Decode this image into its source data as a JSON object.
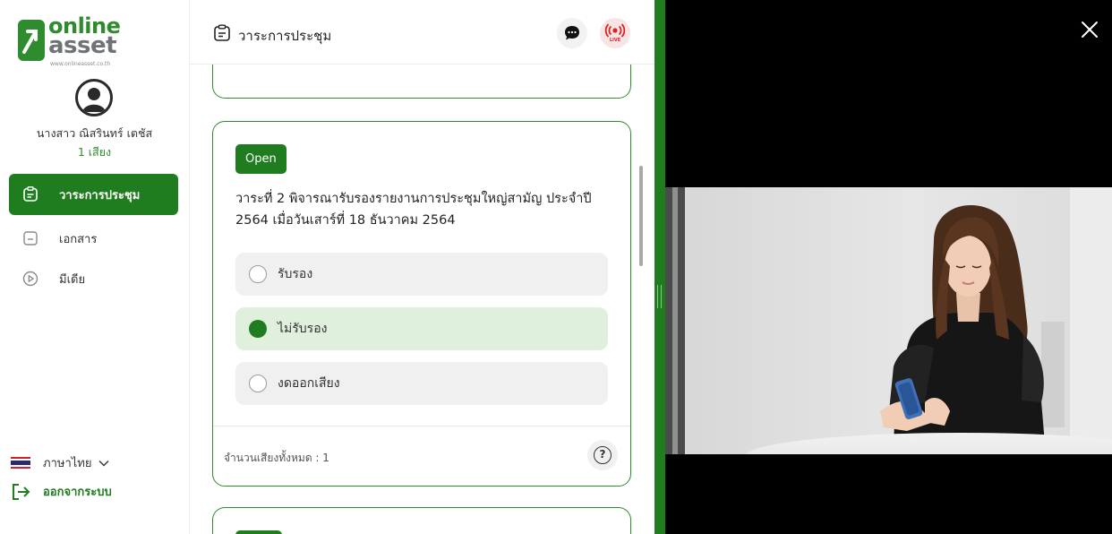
{
  "logo": {
    "brand_top": "online",
    "brand_bottom": "asset",
    "url": "www.onlineasset.co.th"
  },
  "user": {
    "name": "นางสาว ณิสรินทร์ เตชัส",
    "votes": "1 เสียง"
  },
  "sidebar": {
    "items": [
      {
        "label": "วาระการประชุม",
        "icon": "agenda-icon",
        "active": true
      },
      {
        "label": "เอกสาร",
        "icon": "document-icon",
        "active": false
      },
      {
        "label": "มีเดีย",
        "icon": "media-play-icon",
        "active": false
      }
    ],
    "language_label": "ภาษาไทย",
    "logout_label": "ออกจากระบบ"
  },
  "header": {
    "title": "วาระการประชุม",
    "live_label": "LIVE"
  },
  "agenda_card": {
    "status": "Open",
    "title": "วาระที่ 2 พิจารณารับรองรายงานการประชุมใหญ่สามัญ ประจำปี 2564 เมื่อวันเสาร์ที่ 18 ธันวาคม 2564",
    "options": [
      {
        "label": "รับรอง",
        "selected": false
      },
      {
        "label": "ไม่รับรอง",
        "selected": true
      },
      {
        "label": "งดออกเสียง",
        "selected": false
      }
    ],
    "total_votes": "จำนวนเสียงทั้งหมด : 1",
    "help_symbol": "?"
  },
  "colors": {
    "brand_green": "#1f7d1f",
    "selected_bg": "#dff0dc",
    "live_red": "#dd2222"
  }
}
